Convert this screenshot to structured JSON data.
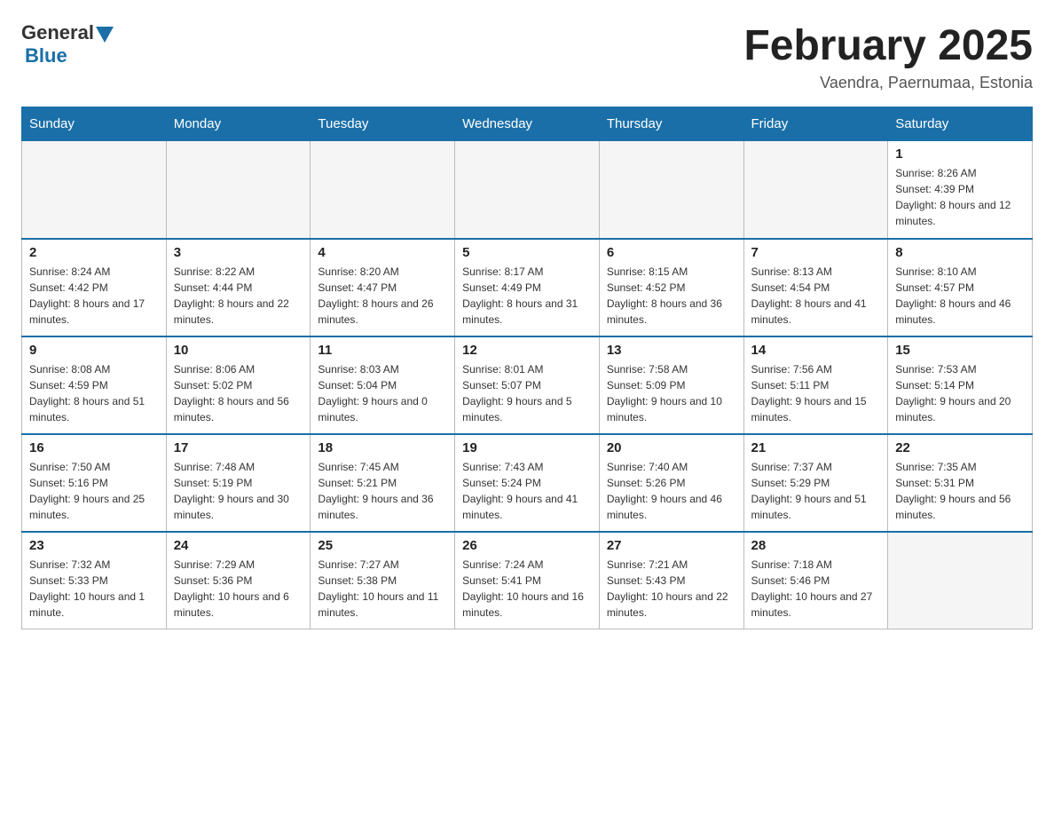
{
  "header": {
    "logo_general": "General",
    "logo_blue": "Blue",
    "title": "February 2025",
    "location": "Vaendra, Paernumaa, Estonia"
  },
  "days_of_week": [
    "Sunday",
    "Monday",
    "Tuesday",
    "Wednesday",
    "Thursday",
    "Friday",
    "Saturday"
  ],
  "weeks": [
    [
      {
        "day": "",
        "info": ""
      },
      {
        "day": "",
        "info": ""
      },
      {
        "day": "",
        "info": ""
      },
      {
        "day": "",
        "info": ""
      },
      {
        "day": "",
        "info": ""
      },
      {
        "day": "",
        "info": ""
      },
      {
        "day": "1",
        "info": "Sunrise: 8:26 AM\nSunset: 4:39 PM\nDaylight: 8 hours and 12 minutes."
      }
    ],
    [
      {
        "day": "2",
        "info": "Sunrise: 8:24 AM\nSunset: 4:42 PM\nDaylight: 8 hours and 17 minutes."
      },
      {
        "day": "3",
        "info": "Sunrise: 8:22 AM\nSunset: 4:44 PM\nDaylight: 8 hours and 22 minutes."
      },
      {
        "day": "4",
        "info": "Sunrise: 8:20 AM\nSunset: 4:47 PM\nDaylight: 8 hours and 26 minutes."
      },
      {
        "day": "5",
        "info": "Sunrise: 8:17 AM\nSunset: 4:49 PM\nDaylight: 8 hours and 31 minutes."
      },
      {
        "day": "6",
        "info": "Sunrise: 8:15 AM\nSunset: 4:52 PM\nDaylight: 8 hours and 36 minutes."
      },
      {
        "day": "7",
        "info": "Sunrise: 8:13 AM\nSunset: 4:54 PM\nDaylight: 8 hours and 41 minutes."
      },
      {
        "day": "8",
        "info": "Sunrise: 8:10 AM\nSunset: 4:57 PM\nDaylight: 8 hours and 46 minutes."
      }
    ],
    [
      {
        "day": "9",
        "info": "Sunrise: 8:08 AM\nSunset: 4:59 PM\nDaylight: 8 hours and 51 minutes."
      },
      {
        "day": "10",
        "info": "Sunrise: 8:06 AM\nSunset: 5:02 PM\nDaylight: 8 hours and 56 minutes."
      },
      {
        "day": "11",
        "info": "Sunrise: 8:03 AM\nSunset: 5:04 PM\nDaylight: 9 hours and 0 minutes."
      },
      {
        "day": "12",
        "info": "Sunrise: 8:01 AM\nSunset: 5:07 PM\nDaylight: 9 hours and 5 minutes."
      },
      {
        "day": "13",
        "info": "Sunrise: 7:58 AM\nSunset: 5:09 PM\nDaylight: 9 hours and 10 minutes."
      },
      {
        "day": "14",
        "info": "Sunrise: 7:56 AM\nSunset: 5:11 PM\nDaylight: 9 hours and 15 minutes."
      },
      {
        "day": "15",
        "info": "Sunrise: 7:53 AM\nSunset: 5:14 PM\nDaylight: 9 hours and 20 minutes."
      }
    ],
    [
      {
        "day": "16",
        "info": "Sunrise: 7:50 AM\nSunset: 5:16 PM\nDaylight: 9 hours and 25 minutes."
      },
      {
        "day": "17",
        "info": "Sunrise: 7:48 AM\nSunset: 5:19 PM\nDaylight: 9 hours and 30 minutes."
      },
      {
        "day": "18",
        "info": "Sunrise: 7:45 AM\nSunset: 5:21 PM\nDaylight: 9 hours and 36 minutes."
      },
      {
        "day": "19",
        "info": "Sunrise: 7:43 AM\nSunset: 5:24 PM\nDaylight: 9 hours and 41 minutes."
      },
      {
        "day": "20",
        "info": "Sunrise: 7:40 AM\nSunset: 5:26 PM\nDaylight: 9 hours and 46 minutes."
      },
      {
        "day": "21",
        "info": "Sunrise: 7:37 AM\nSunset: 5:29 PM\nDaylight: 9 hours and 51 minutes."
      },
      {
        "day": "22",
        "info": "Sunrise: 7:35 AM\nSunset: 5:31 PM\nDaylight: 9 hours and 56 minutes."
      }
    ],
    [
      {
        "day": "23",
        "info": "Sunrise: 7:32 AM\nSunset: 5:33 PM\nDaylight: 10 hours and 1 minute."
      },
      {
        "day": "24",
        "info": "Sunrise: 7:29 AM\nSunset: 5:36 PM\nDaylight: 10 hours and 6 minutes."
      },
      {
        "day": "25",
        "info": "Sunrise: 7:27 AM\nSunset: 5:38 PM\nDaylight: 10 hours and 11 minutes."
      },
      {
        "day": "26",
        "info": "Sunrise: 7:24 AM\nSunset: 5:41 PM\nDaylight: 10 hours and 16 minutes."
      },
      {
        "day": "27",
        "info": "Sunrise: 7:21 AM\nSunset: 5:43 PM\nDaylight: 10 hours and 22 minutes."
      },
      {
        "day": "28",
        "info": "Sunrise: 7:18 AM\nSunset: 5:46 PM\nDaylight: 10 hours and 27 minutes."
      },
      {
        "day": "",
        "info": ""
      }
    ]
  ]
}
